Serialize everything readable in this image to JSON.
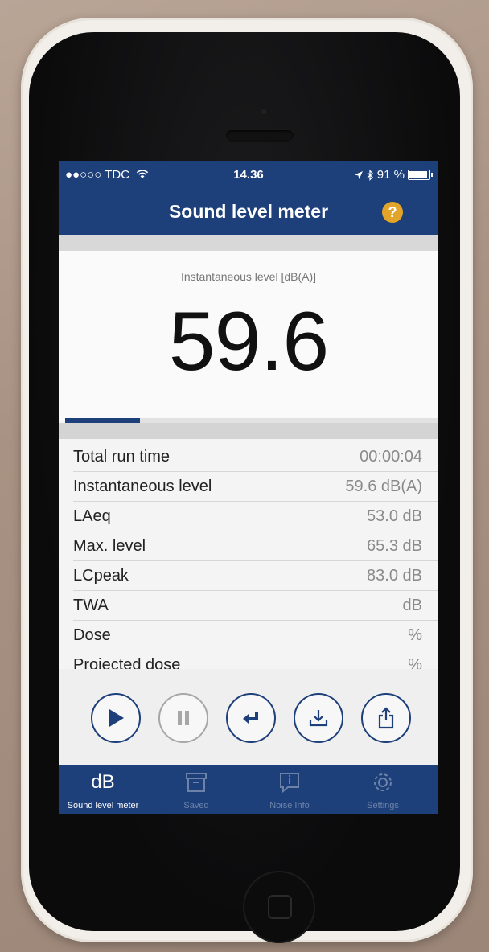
{
  "status_bar": {
    "carrier": "●●○○○ TDC",
    "time": "14.36",
    "battery": "91 %",
    "battery_level": 0.91
  },
  "header": {
    "title": "Sound level meter",
    "help_icon": "?"
  },
  "meter": {
    "label": "Instantaneous level [dB(A)]",
    "value": "59.6",
    "progress": 0.2
  },
  "stats": [
    {
      "label": "Total run time",
      "value": "00:00:04"
    },
    {
      "label": "Instantaneous level",
      "value": "59.6 dB(A)"
    },
    {
      "label": "LAeq",
      "value": "53.0 dB"
    },
    {
      "label": "Max. level",
      "value": "65.3 dB"
    },
    {
      "label": "LCpeak",
      "value": "83.0 dB"
    },
    {
      "label": "TWA",
      "value": "dB"
    },
    {
      "label": "Dose",
      "value": "%"
    },
    {
      "label": "Projected dose",
      "value": "%"
    }
  ],
  "controls": [
    {
      "icon": "play-icon",
      "enabled": true
    },
    {
      "icon": "pause-icon",
      "enabled": false
    },
    {
      "icon": "reset-icon",
      "enabled": true
    },
    {
      "icon": "save-download-icon",
      "enabled": true
    },
    {
      "icon": "share-icon",
      "enabled": true
    }
  ],
  "tabs": [
    {
      "label": "Sound level meter",
      "icon_text": "dB",
      "icon": "db-icon",
      "active": true
    },
    {
      "label": "Saved",
      "icon": "archive-icon",
      "active": false
    },
    {
      "label": "Noise Info",
      "icon": "info-icon",
      "active": false
    },
    {
      "label": "Settings",
      "icon": "gear-icon",
      "active": false
    }
  ],
  "colors": {
    "brand": "#1d3f7a",
    "help": "#e2a52a"
  }
}
